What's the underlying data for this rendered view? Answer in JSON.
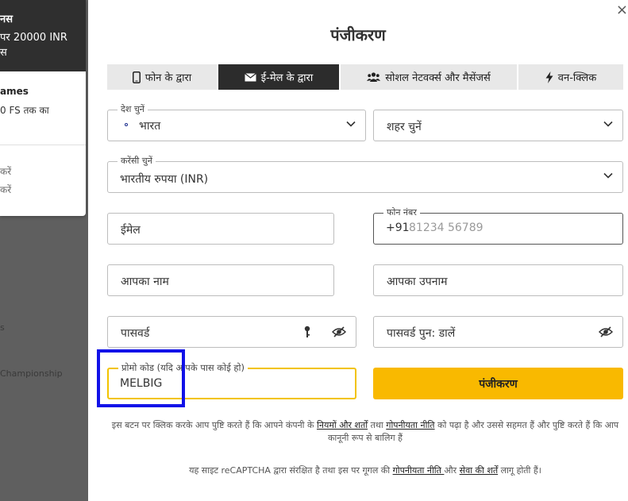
{
  "background": {
    "bonus1_title": "नस",
    "bonus1_text_line1": "पर 20000 INR",
    "bonus1_text_line2": "स",
    "bonus2_title": "ames",
    "bonus2_text_line1": "0 FS तक का",
    "bonus3_line1": "करें",
    "bonus3_line2": "करें",
    "row1": "s",
    "row2": "Championship"
  },
  "modal": {
    "title": "पंजीकरण",
    "close_label": "×"
  },
  "tabs": [
    {
      "label": "फोन के द्वारा",
      "icon": "phone-icon"
    },
    {
      "label": "ई-मेल के द्वारा",
      "icon": "envelope-icon",
      "active": true
    },
    {
      "label": "सोशल नेटवर्क्स और मैसेंजर्स",
      "icon": "users-icon"
    },
    {
      "label": "वन-क्लिक",
      "icon": "bolt-icon"
    }
  ],
  "form": {
    "country_label": "देश चुनें",
    "country_value": "भारत",
    "city_placeholder": "शहर चुनें",
    "currency_label": "करेंसी चुनें",
    "currency_value": "भारतीय रुपया (INR)",
    "email_placeholder": "ईमेल",
    "phone_label": "फोन नंबर",
    "phone_code": "+91",
    "phone_placeholder": "81234 56789",
    "name_placeholder": "आपका नाम",
    "surname_placeholder": "आपका उपनाम",
    "password_placeholder": "पासवर्ड",
    "password_repeat_placeholder": "पासवर्ड पुन: डालें",
    "promo_label": "प्रोमो कोड (यदि आपके पास कोई हो)",
    "promo_value": "MELBIG",
    "register_button": "पंजीकरण"
  },
  "notice1": {
    "pre": "इस बटन पर क्लिक करके आप पुष्टि करते हैं कि आपने कंपनी के ",
    "link1": "नियमों और शर्तों",
    "mid1": " तथा ",
    "link2": "गोपनीयता नीति",
    "post": " को पढ़ा है और उससे सहमत हैं और पुष्टि करते हैं कि आप कानूनी रूप से बालिग हैं"
  },
  "notice2": {
    "pre": "यह साइट reCAPTCHA द्वारा संरक्षित है तथा इस पर गूगल की ",
    "link1": "गोपनीयता नीति ",
    "mid1": "और ",
    "link2": "सेवा की शर्तें",
    "post": " लागू होती हैं।"
  },
  "colors": {
    "accent": "#f9b900",
    "tab_active": "#2c2c2c",
    "highlight": "#1212e8"
  }
}
